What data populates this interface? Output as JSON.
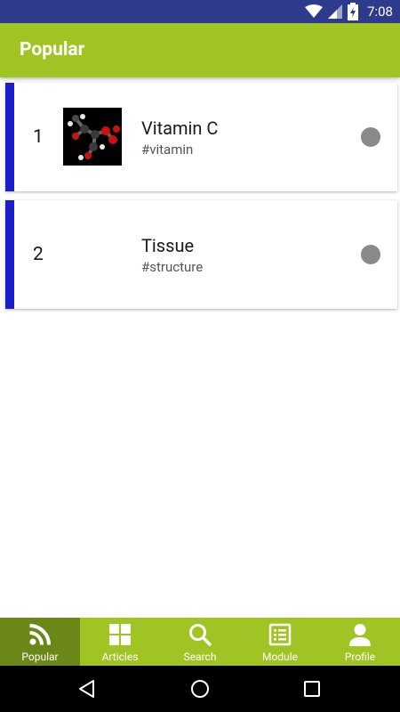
{
  "status_bar": {
    "time": "7:08",
    "icons": [
      "wifi-icon",
      "cell-signal-icon",
      "battery-icon"
    ]
  },
  "app_bar": {
    "title": "Popular"
  },
  "colors": {
    "primary": "#a0c424",
    "primary_dark": "#6b8717",
    "accent": "#1a1ec9",
    "status_bar": "#2e3a8c",
    "dot": "#8a8a8a"
  },
  "items": [
    {
      "rank": "1",
      "title": "Vitamin C",
      "tag": "#vitamin",
      "thumbnail": "molecule-image"
    },
    {
      "rank": "2",
      "title": "Tissue",
      "tag": "#structure",
      "thumbnail": ""
    }
  ],
  "bottom_nav": {
    "items": [
      {
        "label": "Popular",
        "icon": "rss-icon",
        "active": true
      },
      {
        "label": "Articles",
        "icon": "grid-icon",
        "active": false
      },
      {
        "label": "Search",
        "icon": "search-icon",
        "active": false
      },
      {
        "label": "Module",
        "icon": "list-icon",
        "active": false
      },
      {
        "label": "Profile",
        "icon": "person-icon",
        "active": false
      }
    ]
  },
  "system_nav": {
    "buttons": [
      "back-icon",
      "home-icon",
      "recents-icon"
    ]
  }
}
